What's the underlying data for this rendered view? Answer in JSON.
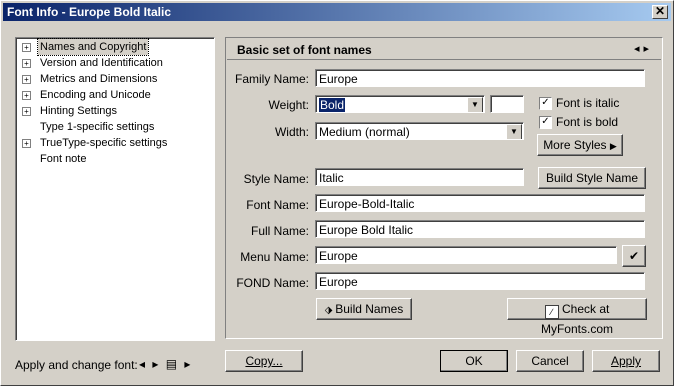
{
  "window": {
    "title": "Font Info - Europe Bold Italic",
    "close_glyph": "✕"
  },
  "tree": {
    "items": [
      {
        "label": "Names and Copyright",
        "expander": "+",
        "selected": true
      },
      {
        "label": "Version and Identification",
        "expander": "+"
      },
      {
        "label": "Metrics and Dimensions",
        "expander": "+"
      },
      {
        "label": "Encoding and Unicode",
        "expander": "+"
      },
      {
        "label": "Hinting Settings",
        "expander": "+"
      },
      {
        "label": "Type 1-specific settings",
        "expander": ""
      },
      {
        "label": "TrueType-specific settings",
        "expander": "+"
      },
      {
        "label": "Font note",
        "expander": ""
      }
    ]
  },
  "panel": {
    "title": "Basic set of font names",
    "nav_glyphs": "◂▸"
  },
  "form": {
    "family_label": "Family Name:",
    "family_value": "Europe",
    "weight_label": "Weight:",
    "weight_value": "Bold",
    "weight_code": "",
    "width_label": "Width:",
    "width_value": "Medium (normal)",
    "italic_label": "Font is italic",
    "italic_checked": "✓",
    "bold_label": "Font is bold",
    "bold_checked": "✓",
    "more_styles": "More Styles",
    "style_label": "Style Name:",
    "style_value": "Italic",
    "build_style": "Build Style Name",
    "font_label": "Font Name:",
    "font_value": "Europe-Bold-Italic",
    "full_label": "Full Name:",
    "full_value": "Europe Bold Italic",
    "menu_label": "Menu Name:",
    "menu_value": "Europe",
    "fond_label": "FOND Name:",
    "fond_value": "Europe",
    "build_names": "Build Names",
    "check_myfonts": "Check at MyFonts.com",
    "check_glyph": "✔"
  },
  "footer": {
    "apply_change_label": "Apply and change font:",
    "nav_glyphs": "◂ ▸ ▤ ▸",
    "copy": "Copy...",
    "ok": "OK",
    "cancel": "Cancel",
    "apply": "Apply"
  },
  "colors": {
    "titlebar_start": "#0a246a",
    "titlebar_end": "#a6caf0",
    "face": "#d4d0c8",
    "selection": "#0a246a"
  }
}
